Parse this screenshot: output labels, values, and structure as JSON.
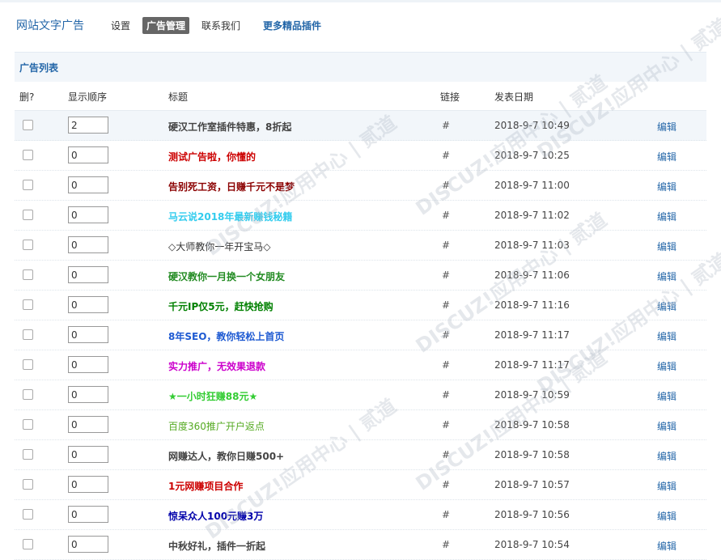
{
  "header": {
    "title": "网站文字广告",
    "nav": [
      {
        "label": "设置",
        "active": false
      },
      {
        "label": "广告管理",
        "active": true
      },
      {
        "label": "联系我们",
        "active": false
      }
    ],
    "more_label": "更多精品插件"
  },
  "section": {
    "title": "广告列表"
  },
  "table": {
    "columns": {
      "delete": "删?",
      "order": "显示顺序",
      "title": "标题",
      "link": "链接",
      "date": "发表日期"
    },
    "edit_label": "编辑",
    "rows": [
      {
        "order": "2",
        "title": "硬汉工作室插件特惠，8折起",
        "color": "#444444",
        "bold": true,
        "link": "#",
        "date": "2018-9-7 10:49"
      },
      {
        "order": "0",
        "title": "测试广告啦，你懂的",
        "color": "#cc0000",
        "bold": true,
        "link": "#",
        "date": "2018-9-7 10:25"
      },
      {
        "order": "0",
        "title": "告别死工资，日赚千元不是梦",
        "color": "#8b0000",
        "bold": true,
        "link": "#",
        "date": "2018-9-7 11:00"
      },
      {
        "order": "0",
        "title": "马云说2018年最新赚钱秘籍",
        "color": "#33ccee",
        "bold": true,
        "link": "#",
        "date": "2018-9-7 11:02"
      },
      {
        "order": "0",
        "title": "◇大师教你一年开宝马◇",
        "color": "#333333",
        "bold": false,
        "link": "#",
        "date": "2018-9-7 11:03"
      },
      {
        "order": "0",
        "title": "硬汉教你一月换一个女朋友",
        "color": "#228b22",
        "bold": true,
        "link": "#",
        "date": "2018-9-7 11:06"
      },
      {
        "order": "0",
        "title": "千元IP仅5元，赶快抢购",
        "color": "#008000",
        "bold": true,
        "link": "#",
        "date": "2018-9-7 11:16"
      },
      {
        "order": "0",
        "title": "8年SEO，教你轻松上首页",
        "color": "#1e5ad2",
        "bold": true,
        "link": "#",
        "date": "2018-9-7 11:17"
      },
      {
        "order": "0",
        "title": "实力推广，无效果退款",
        "color": "#cc00cc",
        "bold": true,
        "link": "#",
        "date": "2018-9-7 11:17"
      },
      {
        "order": "0",
        "title": "★一小时狂赚88元★",
        "color": "#33cc33",
        "bold": true,
        "link": "#",
        "date": "2018-9-7 10:59"
      },
      {
        "order": "0",
        "title": "百度360推广开户返点",
        "color": "#55aa22",
        "bold": false,
        "link": "#",
        "date": "2018-9-7 10:58"
      },
      {
        "order": "0",
        "title": "网赚达人，教你日赚500+",
        "color": "#444444",
        "bold": true,
        "link": "#",
        "date": "2018-9-7 10:58"
      },
      {
        "order": "0",
        "title": "1元网赚项目合作",
        "color": "#cc0000",
        "bold": true,
        "link": "#",
        "date": "2018-9-7 10:57"
      },
      {
        "order": "0",
        "title": "惊呆众人100元赚3万",
        "color": "#0000aa",
        "bold": true,
        "link": "#",
        "date": "2018-9-7 10:56"
      },
      {
        "order": "0",
        "title": "中秋好礼，插件一折起",
        "color": "#444444",
        "bold": true,
        "link": "#",
        "date": "2018-9-7 10:54"
      }
    ]
  },
  "watermark": {
    "text": "DISCUZ!应用中心 | 贰道"
  }
}
